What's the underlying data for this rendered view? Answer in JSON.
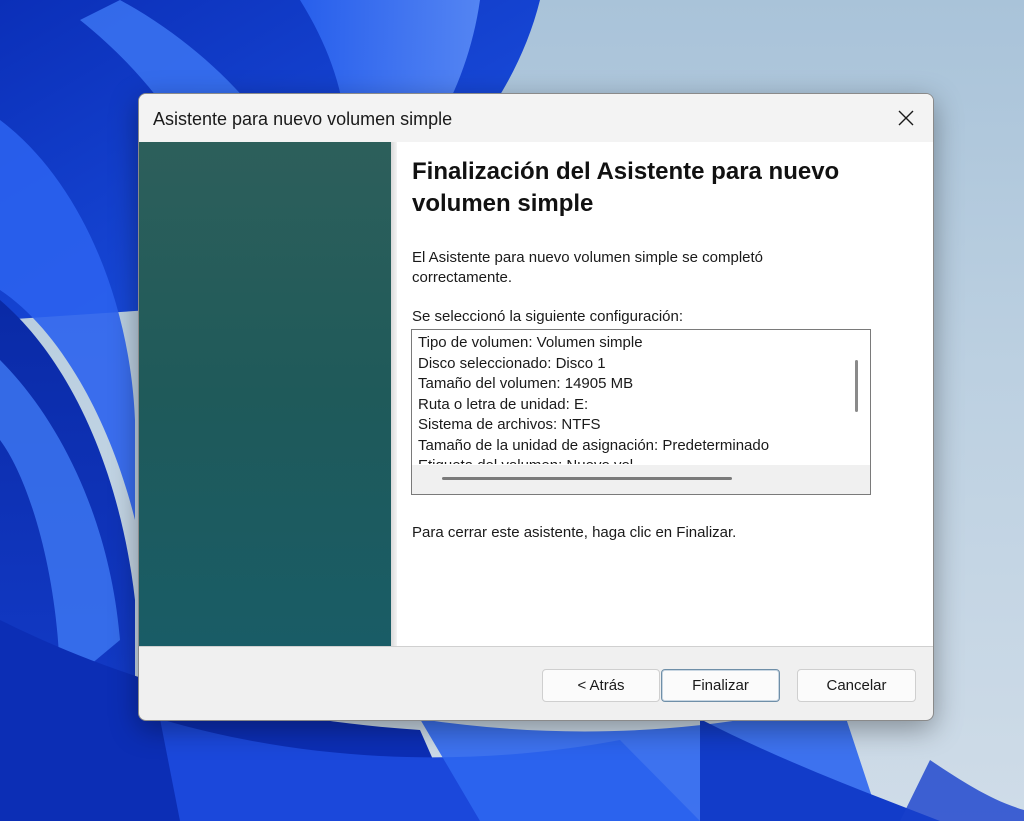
{
  "window": {
    "title": "Asistente para nuevo volumen simple"
  },
  "main": {
    "heading": "Finalización del Asistente para nuevo volumen simple",
    "completed_message": "El Asistente para nuevo volumen simple se completó correctamente.",
    "config_label": "Se seleccionó la siguiente configuración:",
    "config_lines": [
      "Tipo de volumen: Volumen simple",
      "Disco seleccionado: Disco 1",
      "Tamaño del volumen: 14905 MB",
      "Ruta o letra de unidad: E:",
      "Sistema de archivos: NTFS",
      "Tamaño de la unidad de asignación: Predeterminado",
      "Etiqueta del volumen: Nuevo vol"
    ],
    "finish_hint": "Para cerrar este asistente, haga clic en Finalizar."
  },
  "buttons": {
    "back": "< Atrás",
    "finish": "Finalizar",
    "cancel": "Cancelar"
  },
  "icons": {
    "close": "close-icon"
  },
  "colors": {
    "side_panel": "#1f5a5a",
    "wallpaper_blue": "#1a3fd6"
  }
}
